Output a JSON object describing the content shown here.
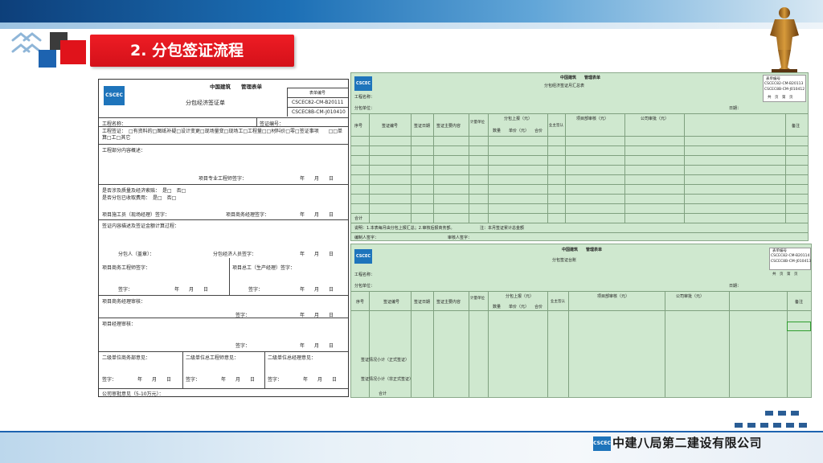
{
  "slide": {
    "title": "2. 分包签证流程",
    "company": "中建八局第二建设有限公司",
    "company_logo": "CSCEC"
  },
  "colors": {
    "brand_blue": "#1d63b0",
    "brand_red": "#e0131b",
    "sheet_green": "#cfe8cf"
  },
  "form": {
    "logo": "CSCEC",
    "header_line": "中国建筑　　管理表单",
    "form_title": "分包经济签证单",
    "code_label": "表单编号",
    "code1": "CSCEC82-CM-B20111",
    "code2": "CSCEC8B-CM-J010410",
    "project_name_label": "工程名称：",
    "sign_no_label": "签证编号：",
    "reason": "工程签证：　□有资料的□图纸补疑□设计变更□现场量变□现场工□工程量□□材料价□零□签证事项　　□□单算□工□其它",
    "work_content_label": "工程部分内容概述：",
    "pm_sign": "项目专业工程师签字：",
    "date_text": "年　　月　　日",
    "warranty_label": "是否涉及质量及经济索赔：　是□　否□",
    "charge_label": "是否分包已收取费用：　是□　否□",
    "fm_label": "项目施工员（现场经理）签字：",
    "eng_label": "项目商务经理签字：",
    "content_label": "签证内容描述及签证金额计算过程：",
    "sub_sign": "分包人（盖章）：",
    "sub_econ_sign": "分包经济人员签字：",
    "dept_sign1": "项目商务工程师签字：",
    "dept_sign2": "项目总工（生产经理）签字：",
    "sign_label": "签字：",
    "pm_mgr_label": "项目商务经理审核：",
    "pd_label": "项目经理审核：",
    "d1": "二级单位商务部意见：",
    "d2": "二级单位总工程师意见：",
    "d3": "二级单位总经理意见：",
    "footer": "公司审批意见（5-10万元）："
  },
  "sheet1": {
    "logo": "CSCEC",
    "header": "中国建筑　　管理表单",
    "title": "分包经济签证月汇总表",
    "code_label": "表单编号",
    "code1": "CSCEC82-CM-B20113",
    "code2": "CSCEC8B-CM-J010412",
    "page_text": "共　页　第　页",
    "project_label": "工程名称：",
    "sub_label": "分包单位：",
    "period_label": "日期：",
    "columns": [
      "序号",
      "签证编号",
      "签证日期",
      "签证主要内容",
      "计量单位",
      "分包上报（元）",
      "业主签认",
      "项目部审核（元）",
      "公司审批（元）",
      "备注"
    ],
    "subcols": [
      "数量",
      "单价（元）",
      "合价"
    ],
    "total_label": "合计",
    "note": "说明：1.本表每月由分包上报汇总；2.审核后报商务部。",
    "note2": "注：本月签证累计总金额",
    "sign1": "编制人签字：",
    "sign2": "审核人签字："
  },
  "sheet2": {
    "logo": "CSCEC",
    "header": "中国建筑　　管理表单",
    "title": "分包签证台账",
    "code_label": "表单编号",
    "code1": "CSCEC82-CM-B20114",
    "code2": "CSCEC8B-CM-J010413",
    "page_text": "共　页　第　页",
    "project_label": "工程名称：",
    "sub_label": "分包单位：",
    "period_label": "日期：",
    "columns": [
      "序号",
      "签证编号",
      "签证日期",
      "签证主要内容",
      "计量单位",
      "分包上报（元）",
      "业主签认",
      "项目部审核（元）",
      "公司审批（元）",
      "备注"
    ],
    "subcols": [
      "数量",
      "单价（元）",
      "合价"
    ],
    "row_a": "签证情况小计（正式签证）",
    "row_b": "签证情况小计（非正式签证）",
    "row_c": "合计"
  }
}
